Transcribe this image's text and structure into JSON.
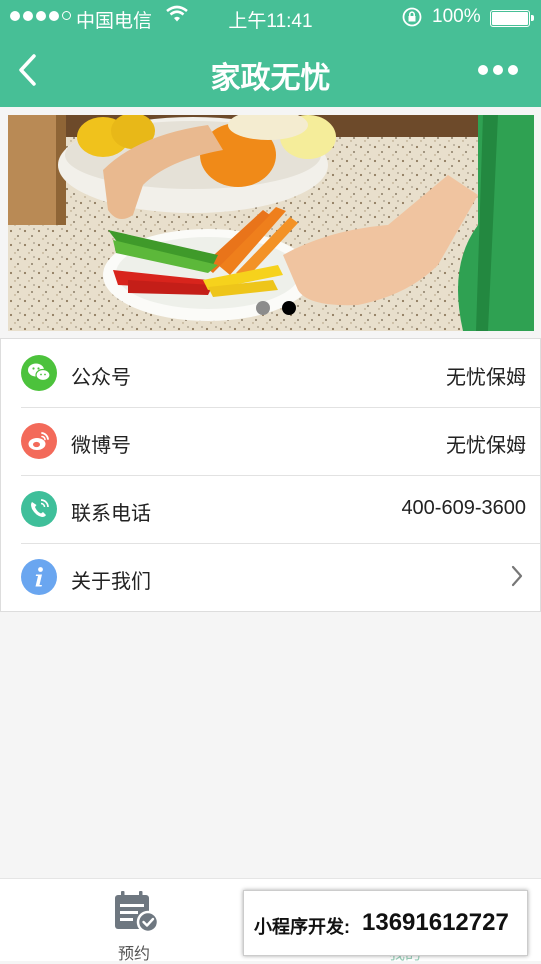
{
  "status_bar": {
    "carrier": "中国电信",
    "time": "上午11:41",
    "battery": "100%",
    "battery_level": 1.0
  },
  "nav": {
    "title": "家政无忧"
  },
  "banner": {
    "page_count": 2,
    "active_page": 2
  },
  "list": [
    {
      "label": "公众号",
      "value": "无忧保姆",
      "icon": "wechat-icon",
      "color": "#4cc23c"
    },
    {
      "label": "微博号",
      "value": "无忧保姆",
      "icon": "weibo-icon",
      "color": "#f36a5a"
    },
    {
      "label": "联系电话",
      "value": "400-609-3600",
      "icon": "phone-icon",
      "color": "#3fbf9a"
    },
    {
      "label": "关于我们",
      "value": "",
      "icon": "info-icon",
      "color": "#6aa6f0"
    }
  ],
  "tabbar": {
    "items": [
      {
        "label": "预约",
        "icon": "calendar-check-icon"
      },
      {
        "label": "我的",
        "icon": "user-icon"
      }
    ]
  },
  "promo": {
    "label": "小程序开发:",
    "number": "13691612727"
  },
  "colors": {
    "brand": "#47bf96"
  }
}
